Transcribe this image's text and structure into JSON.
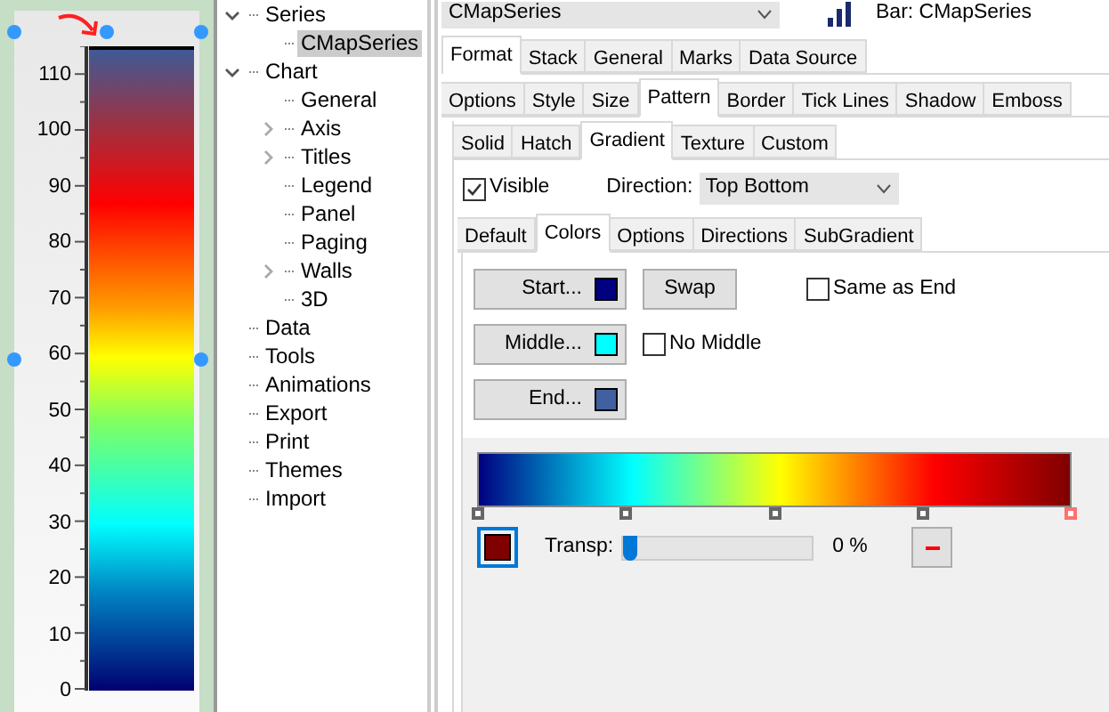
{
  "chart": {
    "axis_labels": [
      "110",
      "100",
      "90",
      "80",
      "70",
      "60",
      "50",
      "40",
      "30",
      "20",
      "10",
      "0"
    ]
  },
  "tree": [
    {
      "label": "Series",
      "expanded": true,
      "selected": false,
      "children": [
        {
          "label": "CMapSeries",
          "selected": true
        }
      ]
    },
    {
      "label": "Chart",
      "expanded": true,
      "selected": false,
      "children": [
        {
          "label": "General",
          "selected": false
        },
        {
          "label": "Axis",
          "expanded": false,
          "selected": false
        },
        {
          "label": "Titles",
          "expanded": false,
          "selected": false
        },
        {
          "label": "Legend",
          "selected": false
        },
        {
          "label": "Panel",
          "selected": false
        },
        {
          "label": "Paging",
          "selected": false
        },
        {
          "label": "Walls",
          "expanded": false,
          "selected": false
        },
        {
          "label": "3D",
          "selected": false
        }
      ]
    },
    {
      "label": "Data",
      "selected": false
    },
    {
      "label": "Tools",
      "selected": false
    },
    {
      "label": "Animations",
      "selected": false
    },
    {
      "label": "Export",
      "selected": false
    },
    {
      "label": "Print",
      "selected": false
    },
    {
      "label": "Themes",
      "selected": false
    },
    {
      "label": "Import",
      "selected": false
    }
  ],
  "series_selector": {
    "value": "CMapSeries"
  },
  "series_title": "Bar: CMapSeries",
  "tabs_main": [
    {
      "label": "Format",
      "selected": true
    },
    {
      "label": "Stack",
      "selected": false
    },
    {
      "label": "General",
      "selected": false
    },
    {
      "label": "Marks",
      "selected": false
    },
    {
      "label": "Data Source",
      "selected": false
    }
  ],
  "tabs_format": [
    {
      "label": "Options",
      "selected": false
    },
    {
      "label": "Style",
      "selected": false
    },
    {
      "label": "Size",
      "selected": false
    },
    {
      "label": "Pattern",
      "selected": true
    },
    {
      "label": "Border",
      "selected": false
    },
    {
      "label": "Tick Lines",
      "selected": false
    },
    {
      "label": "Shadow",
      "selected": false
    },
    {
      "label": "Emboss",
      "selected": false
    }
  ],
  "tabs_pattern": [
    {
      "label": "Solid",
      "selected": false
    },
    {
      "label": "Hatch",
      "selected": false
    },
    {
      "label": "Gradient",
      "selected": true
    },
    {
      "label": "Texture",
      "selected": false
    },
    {
      "label": "Custom",
      "selected": false
    }
  ],
  "visible": {
    "label": "Visible",
    "checked": true
  },
  "direction": {
    "label": "Direction:",
    "value": "Top Bottom"
  },
  "tabs_gradient": [
    {
      "label": "Default",
      "selected": false
    },
    {
      "label": "Colors",
      "selected": true
    },
    {
      "label": "Options",
      "selected": false
    },
    {
      "label": "Directions",
      "selected": false
    },
    {
      "label": "SubGradient",
      "selected": false
    }
  ],
  "color_buttons": [
    {
      "label": "Start...",
      "color": "#000080"
    },
    {
      "label": "Middle...",
      "color": "#00ffff"
    },
    {
      "label": "End...",
      "color": "#4060a0"
    }
  ],
  "swap_button": "Swap",
  "same_as_end": {
    "label": "Same as End",
    "checked": false
  },
  "no_middle": {
    "label": "No Middle",
    "checked": false
  },
  "gradient_editor": {
    "stops": [
      {
        "selected": false
      },
      {
        "selected": false
      },
      {
        "selected": false
      },
      {
        "selected": false
      },
      {
        "selected": true
      }
    ],
    "current_swatch": {
      "color": "#800000"
    },
    "transparency": {
      "label": "Transp:",
      "level": 0,
      "reading": "0 %"
    }
  }
}
